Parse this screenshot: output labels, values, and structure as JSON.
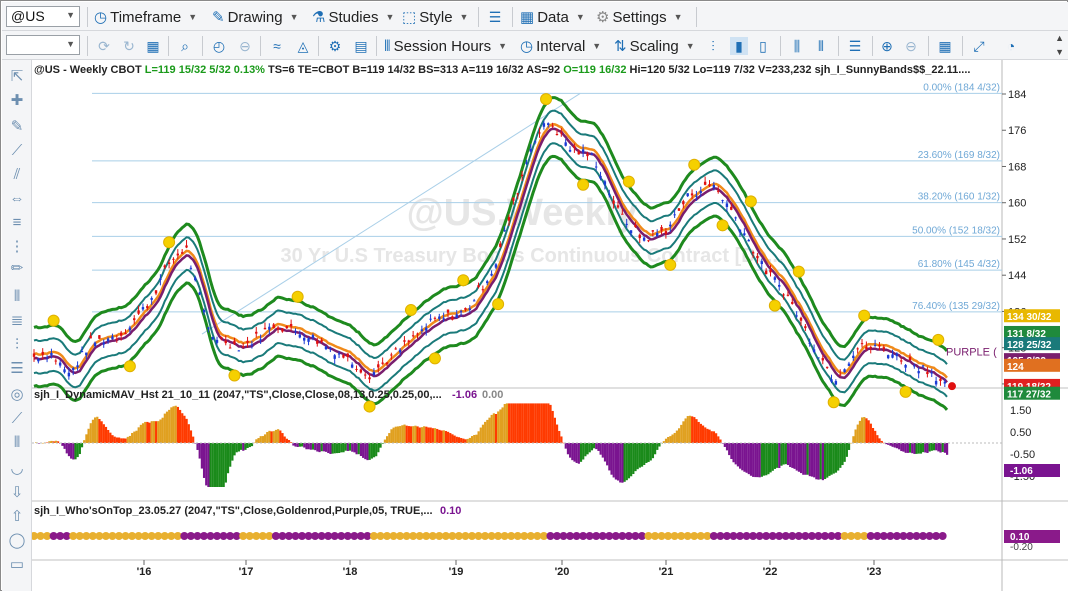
{
  "toolbar1": {
    "symbol": "@US",
    "timeframe": "Timeframe",
    "drawing": "Drawing",
    "studies": "Studies",
    "style": "Style",
    "data": "Data",
    "settings": "Settings"
  },
  "toolbar2": {
    "session_hours": "Session Hours",
    "interval": "Interval",
    "scaling": "Scaling"
  },
  "header": {
    "line": "@US - Weekly  CBOT  L=119 15/32  5/32  0.13%  TS=6  TE=CBOT  B=119 14/32  BS=313  A=119 16/32  AS=92  O=119 16/32  Hi=120 5/32  Lo=119 7/32  V=233,232  sjh_I_SunnyBands$$_22.11...."
  },
  "watermark": {
    "title": "@US,Weekly",
    "subtitle": "30 Yr U.S Treasury Bonds Continuous Contract [De..."
  },
  "fib": [
    {
      "label": "0.00% (184 4/32)",
      "value": 184.125
    },
    {
      "label": "23.60% (169 8/32)",
      "value": 169.25
    },
    {
      "label": "38.20% (160 1/32)",
      "value": 160.03
    },
    {
      "label": "50.00% (152 18/32)",
      "value": 152.56
    },
    {
      "label": "61.80% (145 4/32)",
      "value": 145.125
    },
    {
      "label": "76.40% (135 29/32)",
      "value": 135.9
    }
  ],
  "price_axis": {
    "ticks": [
      "184",
      "176",
      "168",
      "160",
      "152",
      "144",
      "136",
      "128",
      "120"
    ],
    "tags": [
      {
        "text": "134 30/32",
        "color": "#e8b800"
      },
      {
        "text": "131 8/32",
        "color": "#1f8a3c"
      },
      {
        "text": "128 25/32",
        "color": "#1a7a7a"
      },
      {
        "text": "125 8/32",
        "color": "#7a1e6e"
      },
      {
        "text": "124",
        "color": "#e07020"
      },
      {
        "text": "119 18/32",
        "color": "#e02020"
      },
      {
        "text": "117 27/32",
        "color": "#1f8a3c"
      }
    ],
    "purple_label": "PURPLE ("
  },
  "panel2": {
    "title": "sjh_I_DynamicMAV_Hst 21_10_11 (2047,\"TS\",Close,Close,08,13,0.25,0.25,00,...",
    "v1": "-1.06",
    "v2": "0.00",
    "ticks": [
      "1.50",
      "0.50",
      "-0.50",
      "-1.50"
    ],
    "tag": "-1.06"
  },
  "panel3": {
    "title": "sjh_I_Who'sOnTop_23.05.27 (2047,\"TS\",Close,Goldenrod,Purple,05,  TRUE,...",
    "v1": "0.10",
    "tag": "0.10",
    "tick": "-0.20"
  },
  "time_axis": [
    "'16",
    "'17",
    "'18",
    "'19",
    "'20",
    "'21",
    "'22",
    "'23"
  ],
  "colors": {
    "accent": "#1f6fb5",
    "band_outer": "#1e8a1e",
    "band_inner": "#1a7a7a",
    "ma_orange": "#f08a1a",
    "ma_purple": "#7a1e6e",
    "fib": "#a9cfe8",
    "hist_red": "#ff3a00",
    "hist_gold": "#e0a020",
    "hist_green": "#1a8a1a",
    "hist_purple": "#7a1490"
  }
}
